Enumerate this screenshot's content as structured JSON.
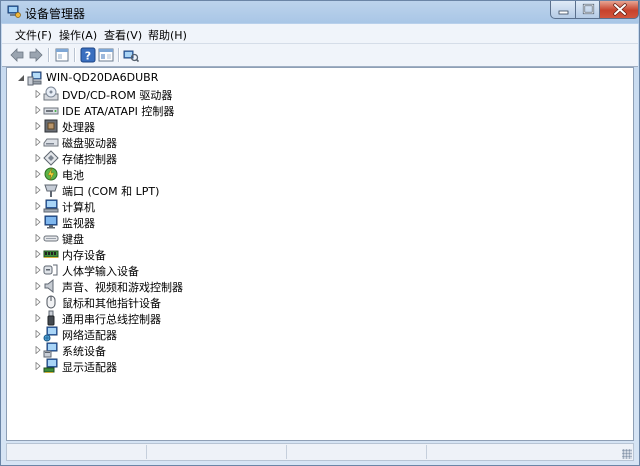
{
  "window": {
    "title": "设备管理器"
  },
  "menu": [
    {
      "label": "文件(F)"
    },
    {
      "label": "操作(A)"
    },
    {
      "label": "查看(V)"
    },
    {
      "label": "帮助(H)"
    }
  ],
  "toolbar": {
    "buttons": [
      "back-arrow-icon",
      "forward-arrow-icon",
      "properties-icon",
      "help-icon",
      "view-icon",
      "scan-hardware-icon"
    ]
  },
  "tree": {
    "root": {
      "label": "WIN-QD20DA6DUBR",
      "icon": "computer-icon",
      "expanded": true
    },
    "items": [
      {
        "label": "DVD/CD-ROM 驱动器",
        "icon": "dvd-drive-icon"
      },
      {
        "label": "IDE ATA/ATAPI 控制器",
        "icon": "ide-controller-icon"
      },
      {
        "label": "处理器",
        "icon": "processor-icon"
      },
      {
        "label": "磁盘驱动器",
        "icon": "disk-drive-icon"
      },
      {
        "label": "存储控制器",
        "icon": "storage-controller-icon"
      },
      {
        "label": "电池",
        "icon": "battery-icon"
      },
      {
        "label": "端口 (COM 和 LPT)",
        "icon": "port-icon"
      },
      {
        "label": "计算机",
        "icon": "computer-icon"
      },
      {
        "label": "监视器",
        "icon": "monitor-icon"
      },
      {
        "label": "键盘",
        "icon": "keyboard-icon"
      },
      {
        "label": "内存设备",
        "icon": "memory-icon"
      },
      {
        "label": "人体学输入设备",
        "icon": "hid-icon"
      },
      {
        "label": "声音、视频和游戏控制器",
        "icon": "sound-icon"
      },
      {
        "label": "鼠标和其他指针设备",
        "icon": "mouse-icon"
      },
      {
        "label": "通用串行总线控制器",
        "icon": "usb-icon"
      },
      {
        "label": "网络适配器",
        "icon": "network-adapter-icon"
      },
      {
        "label": "系统设备",
        "icon": "system-devices-icon"
      },
      {
        "label": "显示适配器",
        "icon": "display-adapter-icon"
      }
    ]
  }
}
